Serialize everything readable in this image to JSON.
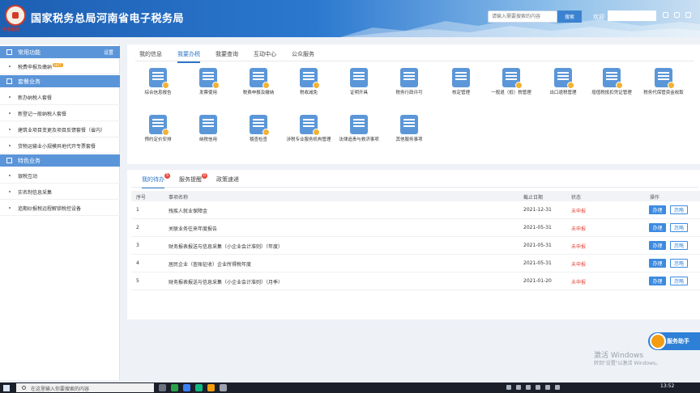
{
  "header": {
    "logo_text": "中国税务",
    "title": "国家税务总局河南省电子税务局",
    "search_placeholder": "请输入需要搜索的内容",
    "search_button": "搜索",
    "welcome": "欢迎"
  },
  "sidebar": {
    "sections": [
      {
        "title": "常用功能",
        "right": "设置",
        "items": [
          {
            "label": "税费申报及缴纳",
            "hot": "HOT"
          }
        ]
      },
      {
        "title": "套餐业务",
        "items": [
          {
            "label": "新办纳税人套餐"
          },
          {
            "label": "新登记一般纳税人套餐"
          },
          {
            "label": "建筑业项目变更及项目反馈套餐（省内）"
          },
          {
            "label": "货物运输业小规模异地代开专票套餐"
          }
        ]
      },
      {
        "title": "特色业务",
        "items": [
          {
            "label": "银税互动"
          },
          {
            "label": "实名制信息采集"
          },
          {
            "label": "追期纱报税远程解锁税控设备"
          }
        ]
      }
    ]
  },
  "service_tabs": [
    {
      "label": "我的信息",
      "active": false
    },
    {
      "label": "我要办税",
      "active": true
    },
    {
      "label": "我要查询",
      "active": false
    },
    {
      "label": "互动中心",
      "active": false
    },
    {
      "label": "公众服务",
      "active": false
    }
  ],
  "services": [
    {
      "label": "综合信息报告",
      "icon": "monitor-icon",
      "color": "#4a90d9"
    },
    {
      "label": "发票使用",
      "icon": "invoice-icon",
      "color": "#f0a020"
    },
    {
      "label": "税费申报及缴纳",
      "icon": "tax-filing-icon",
      "color": "#4a90d9"
    },
    {
      "label": "税收减免",
      "icon": "folder-icon",
      "color": "#4a90d9"
    },
    {
      "label": "证明开具",
      "icon": "document-icon",
      "color": "#4a90d9"
    },
    {
      "label": "税务行政许可",
      "icon": "badge-icon",
      "color": "#4a90d9"
    },
    {
      "label": "核定管理",
      "icon": "briefcase-icon",
      "color": "#4a90d9"
    },
    {
      "label": "一般退（抵）税管理",
      "icon": "refund-icon",
      "color": "#4a90d9"
    },
    {
      "label": "出口退税管理",
      "icon": "export-icon",
      "color": "#4a90d9"
    },
    {
      "label": "增值税抵扣凭证管理",
      "icon": "voucher-icon",
      "color": "#4a90d9"
    },
    {
      "label": "税务代保管资金收取",
      "icon": "fund-icon",
      "color": "#4a90d9"
    },
    {
      "label": "预约定价安排",
      "icon": "calendar-icon",
      "color": "#4a90d9"
    },
    {
      "label": "纳税信用",
      "icon": "credit-icon",
      "color": "#4a90d9"
    },
    {
      "label": "稽查检查",
      "icon": "inspect-icon",
      "color": "#4a90d9"
    },
    {
      "label": "涉税专业服务机构管理",
      "icon": "agency-icon",
      "color": "#4a90d9"
    },
    {
      "label": "法律追责与救济事项",
      "icon": "gavel-icon",
      "color": "#4a90d9"
    },
    {
      "label": "其他服务事项",
      "icon": "other-service-icon",
      "color": "#4a90d9"
    }
  ],
  "task_tabs": [
    {
      "label": "我的待办",
      "active": true,
      "count": "5"
    },
    {
      "label": "服务提醒",
      "active": false,
      "count": "0"
    },
    {
      "label": "政策速递",
      "active": false,
      "count": ""
    }
  ],
  "table": {
    "headers": [
      "序号",
      "事项名称",
      "截止日期",
      "状态",
      "操作"
    ],
    "rows": [
      {
        "no": "1",
        "name": "残疾人就业保障金",
        "date": "2021-12-31",
        "status": "未申报"
      },
      {
        "no": "2",
        "name": "关联业务往来年度报告",
        "date": "2021-05-31",
        "status": "未申报"
      },
      {
        "no": "3",
        "name": "财务报表报送与信息采集（小企业会计准则）（年度）",
        "date": "2021-05-31",
        "status": "未申报"
      },
      {
        "no": "4",
        "name": "居民企业（查账征收）企业所得税年度",
        "date": "2021-05-31",
        "status": "未申报"
      },
      {
        "no": "5",
        "name": "财务报表报送与信息采集（小企业会计准则）（月季）",
        "date": "2021-01-20",
        "status": "未申报"
      }
    ],
    "action_do": "办理",
    "action_ignore": "忽略"
  },
  "assistant": "服务助手",
  "activation": {
    "line1": "激活 Windows",
    "line2": "转到\"设置\"以激活 Windows。"
  },
  "taskbar": {
    "search_placeholder": "在这里输入你要搜索的内容",
    "time": "13:52"
  }
}
